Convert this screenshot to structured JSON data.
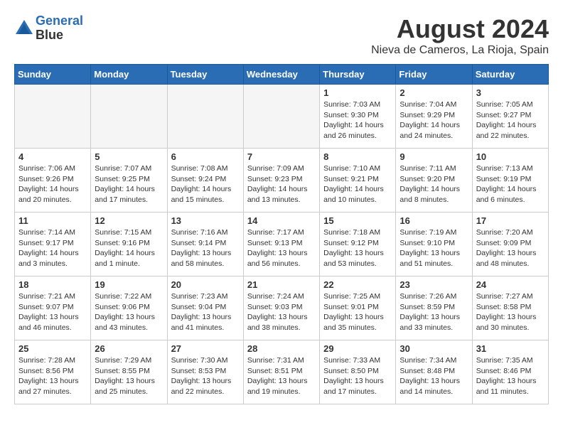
{
  "header": {
    "logo_line1": "General",
    "logo_line2": "Blue",
    "month_year": "August 2024",
    "location": "Nieva de Cameros, La Rioja, Spain"
  },
  "weekdays": [
    "Sunday",
    "Monday",
    "Tuesday",
    "Wednesday",
    "Thursday",
    "Friday",
    "Saturday"
  ],
  "weeks": [
    [
      {
        "day": "",
        "empty": true
      },
      {
        "day": "",
        "empty": true
      },
      {
        "day": "",
        "empty": true
      },
      {
        "day": "",
        "empty": true
      },
      {
        "day": "1",
        "info": "Sunrise: 7:03 AM\nSunset: 9:30 PM\nDaylight: 14 hours\nand 26 minutes."
      },
      {
        "day": "2",
        "info": "Sunrise: 7:04 AM\nSunset: 9:29 PM\nDaylight: 14 hours\nand 24 minutes."
      },
      {
        "day": "3",
        "info": "Sunrise: 7:05 AM\nSunset: 9:27 PM\nDaylight: 14 hours\nand 22 minutes."
      }
    ],
    [
      {
        "day": "4",
        "info": "Sunrise: 7:06 AM\nSunset: 9:26 PM\nDaylight: 14 hours\nand 20 minutes."
      },
      {
        "day": "5",
        "info": "Sunrise: 7:07 AM\nSunset: 9:25 PM\nDaylight: 14 hours\nand 17 minutes."
      },
      {
        "day": "6",
        "info": "Sunrise: 7:08 AM\nSunset: 9:24 PM\nDaylight: 14 hours\nand 15 minutes."
      },
      {
        "day": "7",
        "info": "Sunrise: 7:09 AM\nSunset: 9:23 PM\nDaylight: 14 hours\nand 13 minutes."
      },
      {
        "day": "8",
        "info": "Sunrise: 7:10 AM\nSunset: 9:21 PM\nDaylight: 14 hours\nand 10 minutes."
      },
      {
        "day": "9",
        "info": "Sunrise: 7:11 AM\nSunset: 9:20 PM\nDaylight: 14 hours\nand 8 minutes."
      },
      {
        "day": "10",
        "info": "Sunrise: 7:13 AM\nSunset: 9:19 PM\nDaylight: 14 hours\nand 6 minutes."
      }
    ],
    [
      {
        "day": "11",
        "info": "Sunrise: 7:14 AM\nSunset: 9:17 PM\nDaylight: 14 hours\nand 3 minutes."
      },
      {
        "day": "12",
        "info": "Sunrise: 7:15 AM\nSunset: 9:16 PM\nDaylight: 14 hours\nand 1 minute."
      },
      {
        "day": "13",
        "info": "Sunrise: 7:16 AM\nSunset: 9:14 PM\nDaylight: 13 hours\nand 58 minutes."
      },
      {
        "day": "14",
        "info": "Sunrise: 7:17 AM\nSunset: 9:13 PM\nDaylight: 13 hours\nand 56 minutes."
      },
      {
        "day": "15",
        "info": "Sunrise: 7:18 AM\nSunset: 9:12 PM\nDaylight: 13 hours\nand 53 minutes."
      },
      {
        "day": "16",
        "info": "Sunrise: 7:19 AM\nSunset: 9:10 PM\nDaylight: 13 hours\nand 51 minutes."
      },
      {
        "day": "17",
        "info": "Sunrise: 7:20 AM\nSunset: 9:09 PM\nDaylight: 13 hours\nand 48 minutes."
      }
    ],
    [
      {
        "day": "18",
        "info": "Sunrise: 7:21 AM\nSunset: 9:07 PM\nDaylight: 13 hours\nand 46 minutes."
      },
      {
        "day": "19",
        "info": "Sunrise: 7:22 AM\nSunset: 9:06 PM\nDaylight: 13 hours\nand 43 minutes."
      },
      {
        "day": "20",
        "info": "Sunrise: 7:23 AM\nSunset: 9:04 PM\nDaylight: 13 hours\nand 41 minutes."
      },
      {
        "day": "21",
        "info": "Sunrise: 7:24 AM\nSunset: 9:03 PM\nDaylight: 13 hours\nand 38 minutes."
      },
      {
        "day": "22",
        "info": "Sunrise: 7:25 AM\nSunset: 9:01 PM\nDaylight: 13 hours\nand 35 minutes."
      },
      {
        "day": "23",
        "info": "Sunrise: 7:26 AM\nSunset: 8:59 PM\nDaylight: 13 hours\nand 33 minutes."
      },
      {
        "day": "24",
        "info": "Sunrise: 7:27 AM\nSunset: 8:58 PM\nDaylight: 13 hours\nand 30 minutes."
      }
    ],
    [
      {
        "day": "25",
        "info": "Sunrise: 7:28 AM\nSunset: 8:56 PM\nDaylight: 13 hours\nand 27 minutes."
      },
      {
        "day": "26",
        "info": "Sunrise: 7:29 AM\nSunset: 8:55 PM\nDaylight: 13 hours\nand 25 minutes."
      },
      {
        "day": "27",
        "info": "Sunrise: 7:30 AM\nSunset: 8:53 PM\nDaylight: 13 hours\nand 22 minutes."
      },
      {
        "day": "28",
        "info": "Sunrise: 7:31 AM\nSunset: 8:51 PM\nDaylight: 13 hours\nand 19 minutes."
      },
      {
        "day": "29",
        "info": "Sunrise: 7:33 AM\nSunset: 8:50 PM\nDaylight: 13 hours\nand 17 minutes."
      },
      {
        "day": "30",
        "info": "Sunrise: 7:34 AM\nSunset: 8:48 PM\nDaylight: 13 hours\nand 14 minutes."
      },
      {
        "day": "31",
        "info": "Sunrise: 7:35 AM\nSunset: 8:46 PM\nDaylight: 13 hours\nand 11 minutes."
      }
    ]
  ]
}
